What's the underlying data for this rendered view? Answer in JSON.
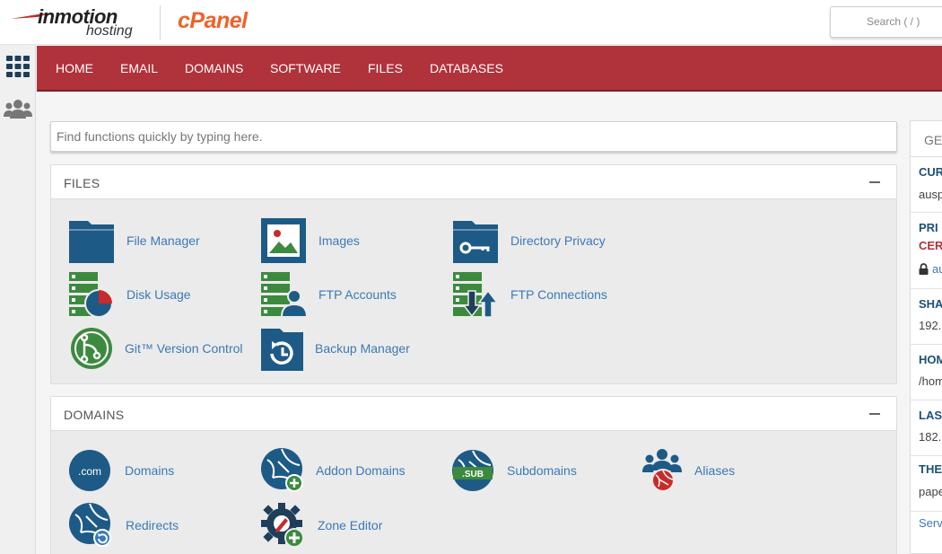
{
  "header": {
    "logo_top": "inmotion",
    "logo_bottom": "hosting",
    "cpanel_logo": "cPanel",
    "search_placeholder": "Search ( / )"
  },
  "sidebar": {
    "icons": [
      "grid-icon",
      "users-icon"
    ]
  },
  "nav": {
    "items": [
      "HOME",
      "EMAIL",
      "DOMAINS",
      "SOFTWARE",
      "FILES",
      "DATABASES"
    ]
  },
  "find": {
    "placeholder": "Find functions quickly by typing here."
  },
  "files": {
    "title": "FILES",
    "items": [
      {
        "label": "File Manager",
        "icon": "file-manager-icon"
      },
      {
        "label": "Images",
        "icon": "images-icon"
      },
      {
        "label": "Directory Privacy",
        "icon": "directory-privacy-icon"
      },
      {
        "label": "Disk Usage",
        "icon": "disk-usage-icon"
      },
      {
        "label": "FTP Accounts",
        "icon": "ftp-accounts-icon"
      },
      {
        "label": "FTP Connections",
        "icon": "ftp-connections-icon"
      },
      {
        "label": "Git™ Version Control",
        "icon": "git-icon"
      },
      {
        "label": "Backup Manager",
        "icon": "backup-manager-icon"
      }
    ]
  },
  "domains": {
    "title": "DOMAINS",
    "items": [
      {
        "label": "Domains",
        "icon": "domains-icon",
        "badge": ".com"
      },
      {
        "label": "Addon Domains",
        "icon": "addon-domains-icon"
      },
      {
        "label": "Subdomains",
        "icon": "subdomains-icon",
        "badge": ".SUB"
      },
      {
        "label": "Aliases",
        "icon": "aliases-icon"
      },
      {
        "label": "Redirects",
        "icon": "redirects-icon"
      },
      {
        "label": "Zone Editor",
        "icon": "zone-editor-icon"
      }
    ]
  },
  "general": {
    "head": "GE",
    "rows": [
      {
        "key": "CUR",
        "value": "ausp"
      },
      {
        "key": "PRI",
        "warn": "CER",
        "value": "au"
      },
      {
        "key": "SHA",
        "value": "192."
      },
      {
        "key": "HOM",
        "value": "/hom"
      },
      {
        "key": "LAS",
        "value": "182."
      },
      {
        "key": "THE",
        "value": "pape"
      }
    ],
    "link": "Serv"
  },
  "colors": {
    "nav_bg": "#b0323a",
    "icon_blue": "#1e5a86",
    "icon_green": "#3c8a3e",
    "icon_red": "#c92a2a",
    "link": "#3b79b8",
    "cpanel_orange": "#f0612a"
  }
}
